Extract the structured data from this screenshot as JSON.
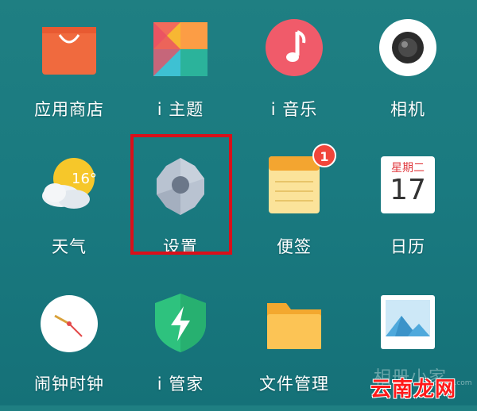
{
  "apps": {
    "row1": [
      {
        "label": "应用商店",
        "icon": "shopping-bag-icon"
      },
      {
        "label": "i 主题",
        "icon": "theme-icon"
      },
      {
        "label": "i 音乐",
        "icon": "music-note-icon"
      },
      {
        "label": "相机",
        "icon": "camera-icon"
      }
    ],
    "row2": [
      {
        "label": "天气",
        "icon": "weather-icon",
        "temp": "16°"
      },
      {
        "label": "设置",
        "icon": "gear-icon"
      },
      {
        "label": "便签",
        "icon": "notes-icon",
        "badge": "1"
      },
      {
        "label": "日历",
        "icon": "calendar-icon",
        "weekday": "星期二",
        "day": "17"
      }
    ],
    "row3": [
      {
        "label": "闹钟时钟",
        "icon": "clock-icon"
      },
      {
        "label": "i 管家",
        "icon": "shield-bolt-icon"
      },
      {
        "label": "文件管理",
        "icon": "folder-icon"
      },
      {
        "label": "相册",
        "icon": "gallery-icon"
      }
    ]
  },
  "highlight_color": "#d9101a",
  "watermark": {
    "text": "云南龙网",
    "faint": "相册小家",
    "sub": "zhijia.com"
  }
}
